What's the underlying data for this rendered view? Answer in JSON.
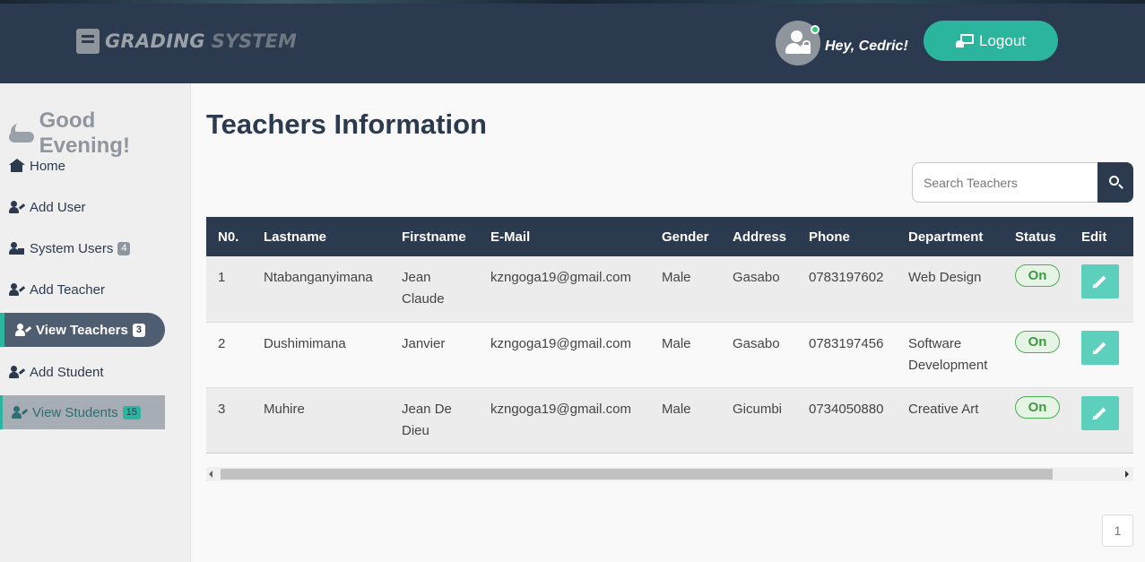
{
  "header": {
    "brand_part1": "GRADING",
    "brand_part2": "SYSTEM",
    "greeting": "Hey, Cedric!",
    "logout_label": "Logout"
  },
  "sidebar": {
    "greeting": "Good Evening!",
    "items": [
      {
        "label": "Home",
        "icon": "home-icon"
      },
      {
        "label": "Add User",
        "icon": "user-edit-icon"
      },
      {
        "label": "System Users",
        "icon": "user-lock-icon",
        "badge": "4"
      },
      {
        "label": "Add Teacher",
        "icon": "user-edit-icon"
      },
      {
        "label": "View Teachers",
        "icon": "teacher-icon",
        "badge": "3",
        "state": "active"
      },
      {
        "label": "Add Student",
        "icon": "user-edit-icon"
      },
      {
        "label": "View Students",
        "icon": "student-icon",
        "badge": "15",
        "state": "highlighted"
      }
    ]
  },
  "main": {
    "title": "Teachers Information",
    "search_placeholder": "Search Teachers",
    "columns": [
      "N0.",
      "Lastname",
      "Firstname",
      "E-Mail",
      "Gender",
      "Address",
      "Phone",
      "Department",
      "Status",
      "Edit"
    ],
    "rows": [
      {
        "no": "1",
        "lastname": "Ntabanganyimana",
        "firstname": "Jean Claude",
        "email": "kzngoga19@gmail.com",
        "gender": "Male",
        "address": "Gasabo",
        "phone": "0783197602",
        "department": "Web Design",
        "status": "On"
      },
      {
        "no": "2",
        "lastname": "Dushimimana",
        "firstname": "Janvier",
        "email": "kzngoga19@gmail.com",
        "gender": "Male",
        "address": "Gasabo",
        "phone": "0783197456",
        "department": "Software Development",
        "status": "On"
      },
      {
        "no": "3",
        "lastname": "Muhire",
        "firstname": "Jean De Dieu",
        "email": "kzngoga19@gmail.com",
        "gender": "Male",
        "address": "Gicumbi",
        "phone": "0734050880",
        "department": "Creative Art",
        "status": "On"
      }
    ],
    "page": "1"
  },
  "colors": {
    "header_bg": "#2c3a4f",
    "accent": "#2bb59e",
    "status_on": "#3c9a3f",
    "edit_button": "#5dcfbd"
  }
}
